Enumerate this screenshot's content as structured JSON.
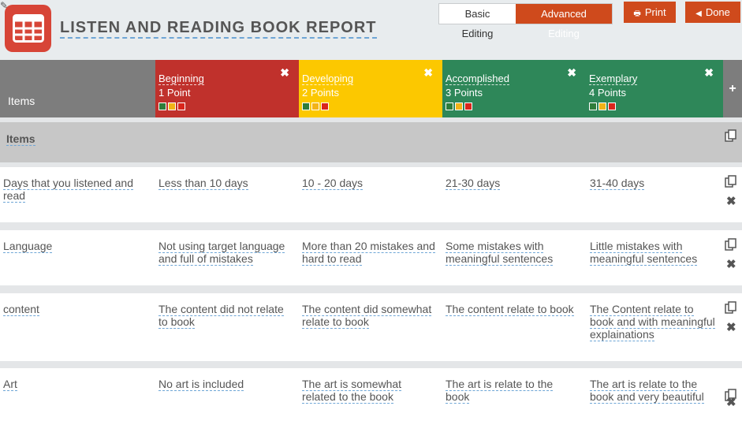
{
  "header": {
    "title": "LISTEN AND READING BOOK REPORT",
    "modes": {
      "basic": "Basic Editing",
      "advanced": "Advanced Editing"
    },
    "print_label": "Print",
    "done_label": "Done"
  },
  "columns": {
    "items_label": "Items",
    "levels": [
      {
        "name": "Beginning",
        "points": "1 Point",
        "color": "#c0312c"
      },
      {
        "name": "Developing",
        "points": "2 Points",
        "color": "#fcc800"
      },
      {
        "name": "Accomplished",
        "points": "3 Points",
        "color": "#2e8759"
      },
      {
        "name": "Exemplary",
        "points": "4 Points",
        "color": "#2e8759"
      }
    ],
    "add_label": "+"
  },
  "section": {
    "title": "Items"
  },
  "rows": [
    {
      "cells": [
        "Days that you listened and read",
        "Less than 10 days",
        "10 - 20 days",
        "21-30 days",
        "31-40 days"
      ]
    },
    {
      "cells": [
        "Language",
        "Not using target language and full of mistakes",
        "More than 20 mistakes and hard to read",
        "Some mistakes with meaningful sentences",
        "Little mistakes with meaningful sentences"
      ]
    },
    {
      "cells": [
        "content",
        "The content did not relate to book",
        "The content did somewhat relate to book",
        "The content relate to book",
        "The Content relate to book and with meaningful explainations"
      ]
    },
    {
      "cells": [
        "Art",
        "No art is included",
        "The art is somewhat related to the book",
        "The art is relate to the book",
        "The art is relate to the book and very beautiful"
      ]
    }
  ],
  "icons": {
    "copy": "copy-icon",
    "delete": "close-icon",
    "print": "print-icon",
    "done": "chevron-left-icon",
    "app": "table-icon",
    "edit": "pencil-icon"
  }
}
